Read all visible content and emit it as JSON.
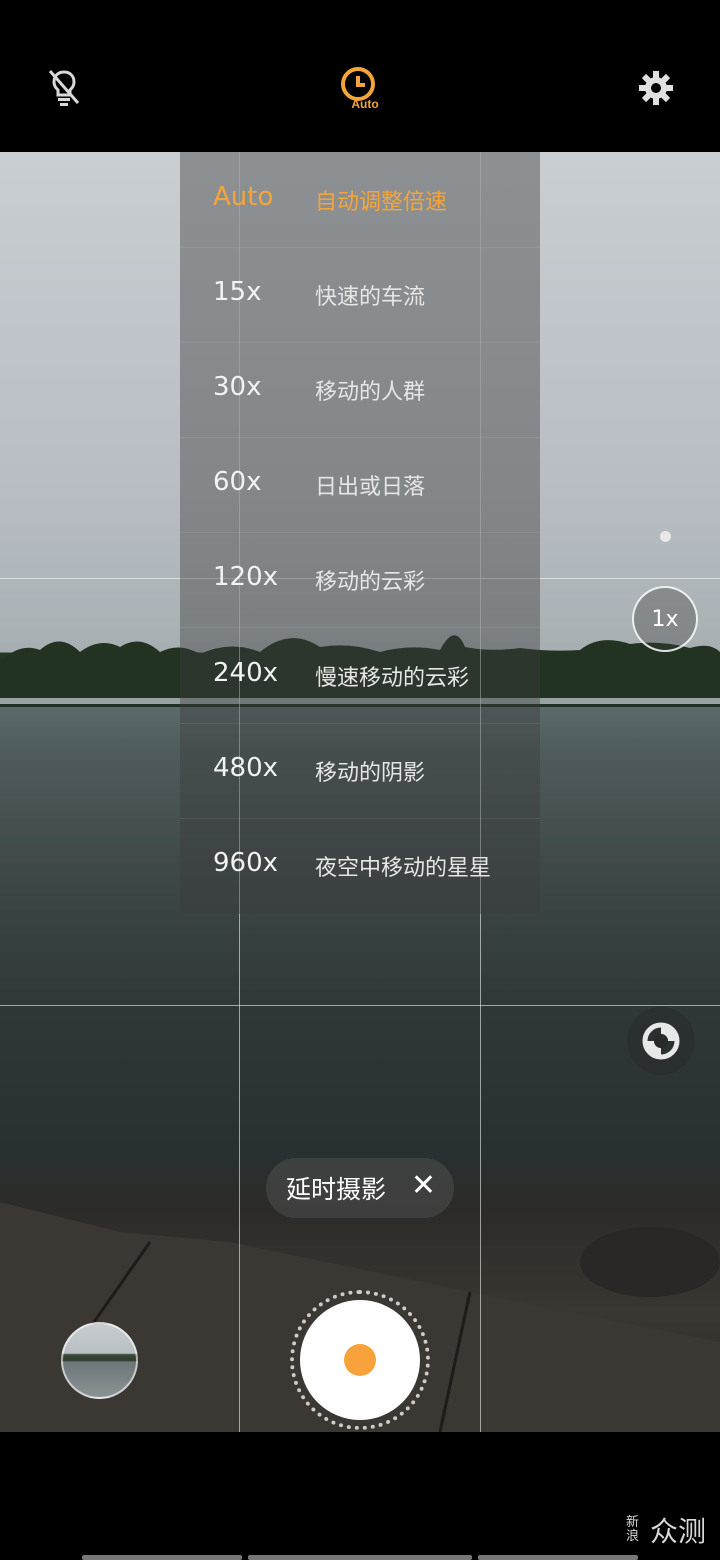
{
  "top_bar": {
    "flash_icon": "flash-off-icon",
    "timer_auto_label": "Auto",
    "settings_icon": "gear-icon"
  },
  "speed_menu": {
    "items": [
      {
        "speed": "Auto",
        "desc": "自动调整倍速",
        "active": true
      },
      {
        "speed": "15x",
        "desc": "快速的车流",
        "active": false
      },
      {
        "speed": "30x",
        "desc": "移动的人群",
        "active": false
      },
      {
        "speed": "60x",
        "desc": "日出或日落",
        "active": false
      },
      {
        "speed": "120x",
        "desc": "移动的云彩",
        "active": false
      },
      {
        "speed": "240x",
        "desc": "慢速移动的云彩",
        "active": false
      },
      {
        "speed": "480x",
        "desc": "移动的阴影",
        "active": false
      },
      {
        "speed": "960x",
        "desc": "夜空中移动的星星",
        "active": false
      }
    ]
  },
  "zoom": {
    "label": "1x"
  },
  "mode_chip": {
    "label": "延时摄影",
    "close": "✕"
  },
  "watermark": {
    "line1": "新",
    "line2": "浪",
    "main": "众测"
  },
  "colors": {
    "accent": "#f4a53a"
  }
}
